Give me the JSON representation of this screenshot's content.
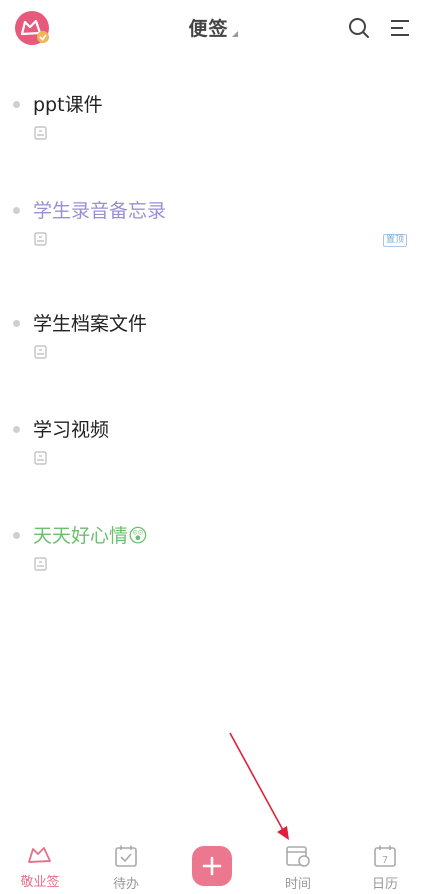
{
  "header": {
    "title": "便签",
    "avatar_icon": "cat-logo-icon",
    "search_icon": "search-icon",
    "menu_icon": "menu-icon"
  },
  "notes": [
    {
      "title": "ppt课件",
      "color": "#222222"
    },
    {
      "title": "学生录音备忘录",
      "color": "#9b8fd4",
      "badge": "置顶"
    },
    {
      "title": "学生档案文件",
      "color": "#222222"
    },
    {
      "title": "学习视频",
      "color": "#222222"
    },
    {
      "title": "天天好心情😲",
      "color": "#6dbf6d"
    }
  ],
  "tabbar": {
    "tabs": [
      {
        "label": "敬业签",
        "icon": "cat-icon",
        "active": true
      },
      {
        "label": "待办",
        "icon": "todo-check-icon"
      },
      {
        "label": "",
        "icon": "plus-icon"
      },
      {
        "label": "时间",
        "icon": "time-calendar-icon"
      },
      {
        "label": "日历",
        "icon": "calendar-icon",
        "day": "7"
      }
    ]
  },
  "colors": {
    "accent": "#e86f8a",
    "fab": "#ec7890",
    "arrow": "#e0203a"
  }
}
